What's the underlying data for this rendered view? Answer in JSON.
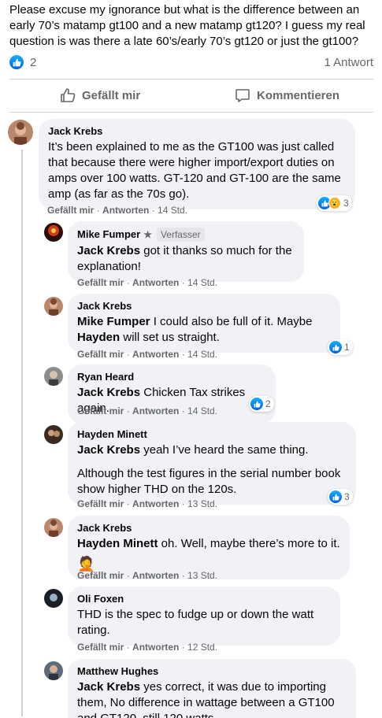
{
  "post": {
    "text": "Please excuse my ignorance but what is the difference between an early 70’s matamp gt100 and a new matamp gt120? I guess my real question is was there a late 60’s/early 70’s gt120 or just the gt100?",
    "reaction_count": "2",
    "answer_count": "1 Antwort",
    "like_label": "Gefällt mir",
    "comment_label": "Kommentieren"
  },
  "comments": [
    {
      "author": "Jack Krebs",
      "text": "It’s been explained to me as the GT100 was just called that because there were higher import/export duties on amps over 100 watts. GT-120 and GT-100 are the same amp (as far as the 70s go).",
      "like": "Gefällt mir",
      "reply": "Antworten",
      "time": "14 Std.",
      "reactions": "3"
    }
  ],
  "replies": [
    {
      "author": "Mike Fumper",
      "role": "Verfasser",
      "mention": "Jack Krebs",
      "text": " got it thanks so much for the explanation!",
      "like": "Gefällt mir",
      "reply": "Antworten",
      "time": "14 Std."
    },
    {
      "author": "Jack Krebs",
      "mention": "Mike Fumper",
      "text": " I could also be full of it. Maybe ",
      "mention2": "Hayden",
      "text2": " will set us straight.",
      "like": "Gefällt mir",
      "reply": "Antworten",
      "time": "14 Std.",
      "reactions": "1"
    },
    {
      "author": "Ryan Heard",
      "mention": "Jack Krebs",
      "text": " Chicken Tax strikes again.",
      "like": "Gefällt mir",
      "reply": "Antworten",
      "time": "14 Std.",
      "reactions": "2"
    },
    {
      "author": "Hayden Minett",
      "mention": "Jack Krebs",
      "text": " yeah I’ve heard the same thing.",
      "text2": "Although the test figures in the serial number book show higher THD on the 120s.",
      "like": "Gefällt mir",
      "reply": "Antworten",
      "time": "13 Std.",
      "reactions": "3"
    },
    {
      "author": "Jack Krebs",
      "mention": "Hayden Minett",
      "text": " oh. Well, maybe there’s more to it.",
      "sticker": "🤦",
      "like": "Gefällt mir",
      "reply": "Antworten",
      "time": "13 Std."
    },
    {
      "author": "Oli Foxen",
      "text": "THD is the spec to fudge up or down the watt rating.",
      "like": "Gefällt mir",
      "reply": "Antworten",
      "time": "12 Std."
    },
    {
      "author": "Matthew Hughes",
      "mention": "Jack Krebs",
      "text": " yes correct, it was due to importing them, No difference in wattage between a GT100 and GT120, still 120 watts"
    }
  ],
  "colors": {
    "bubble": "#f0f2f5",
    "secondary_text": "#65676b",
    "like_blue": "#0062df"
  }
}
